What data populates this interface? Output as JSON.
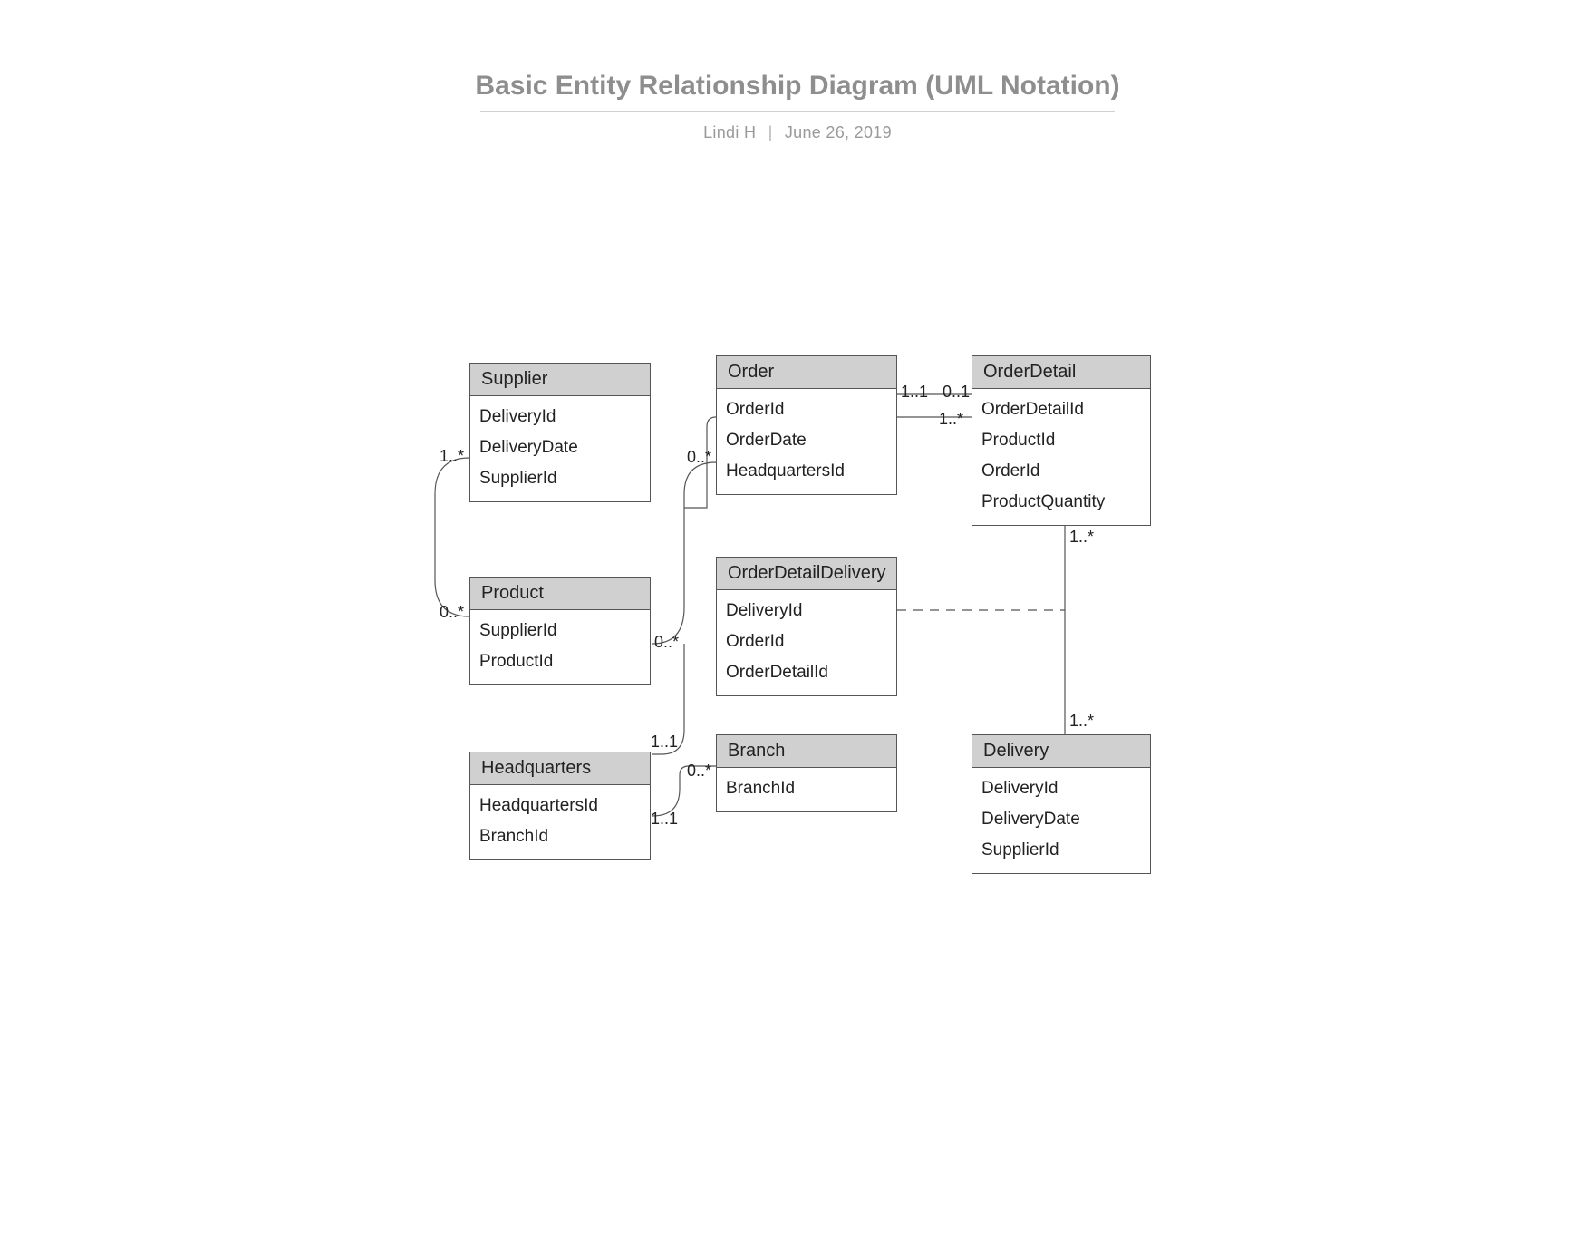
{
  "title": "Basic Entity Relationship Diagram (UML Notation)",
  "author": "Lindi H",
  "date": "June 26, 2019",
  "entities": {
    "supplier": {
      "name": "Supplier",
      "attrs": [
        "DeliveryId",
        "DeliveryDate",
        "SupplierId"
      ]
    },
    "product": {
      "name": "Product",
      "attrs": [
        "SupplierId",
        "ProductId"
      ]
    },
    "headquarters": {
      "name": "Headquarters",
      "attrs": [
        "HeadquartersId",
        "BranchId"
      ]
    },
    "order": {
      "name": "Order",
      "attrs": [
        "OrderId",
        "OrderDate",
        "HeadquartersId"
      ]
    },
    "orderdetail": {
      "name": "OrderDetail",
      "attrs": [
        "OrderDetailId",
        "ProductId",
        "OrderId",
        "ProductQuantity"
      ]
    },
    "orderdetaildelivery": {
      "name": "OrderDetailDelivery",
      "attrs": [
        "DeliveryId",
        "OrderId",
        "OrderDetailId"
      ]
    },
    "branch": {
      "name": "Branch",
      "attrs": [
        "BranchId"
      ]
    },
    "delivery": {
      "name": "Delivery",
      "attrs": [
        "DeliveryId",
        "DeliveryDate",
        "SupplierId"
      ]
    }
  },
  "multiplicities": {
    "supplier_side": "1..*",
    "product_side": "0..*",
    "product_right": "0..*",
    "order_left": "0..*",
    "order_right": "1..1",
    "orderdetail_top": "0..1",
    "orderdetail_below": "1..*",
    "orderdetail_bot": "1..*",
    "delivery_top": "1..*",
    "hq_top": "1..1",
    "hq_right": "1..1",
    "branch_left": "0..*"
  }
}
